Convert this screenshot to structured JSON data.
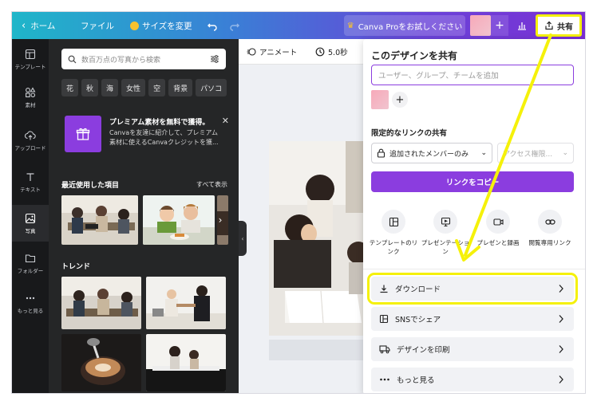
{
  "topbar": {
    "home": "ホーム",
    "file": "ファイル",
    "resize": "サイズを変更",
    "pro": "Canva Proをお試しください",
    "share": "共有"
  },
  "rail": [
    {
      "label": "テンプレート",
      "icon": "template-icon"
    },
    {
      "label": "素材",
      "icon": "elements-icon"
    },
    {
      "label": "アップロード",
      "icon": "upload-icon"
    },
    {
      "label": "テキスト",
      "icon": "text-icon"
    },
    {
      "label": "写真",
      "icon": "photo-icon"
    },
    {
      "label": "フォルダー",
      "icon": "folder-icon"
    },
    {
      "label": "もっと見る",
      "icon": "more-icon"
    }
  ],
  "panel": {
    "search_placeholder": "数百万点の写真から検索",
    "chips": [
      "花",
      "秋",
      "海",
      "女性",
      "空",
      "背景",
      "パソコ"
    ],
    "promo": {
      "title": "プレミアム素材を無料で獲得。",
      "body": "Canvaを友達に紹介して、プレミアム素材に使えるCanvaクレジットを獲..."
    },
    "recent_title": "最近使用した項目",
    "see_all": "すべて表示",
    "trend_title": "トレンド"
  },
  "editor": {
    "animate": "アニメート",
    "duration": "5.0秒"
  },
  "share_panel": {
    "title": "このデザインを共有",
    "input_placeholder": "ユーザー、グループ、チームを追加",
    "restricted_label": "限定的なリンクの共有",
    "access_selected": "追加されたメンバーのみ",
    "access_level": "アクセス権限...",
    "copy_link": "リンクをコピー",
    "options": [
      {
        "label": "テンプレートのリンク",
        "icon": "template-link-icon"
      },
      {
        "label": "プレゼンテーション",
        "icon": "present-icon"
      },
      {
        "label": "プレゼンと録画",
        "icon": "record-icon"
      },
      {
        "label": "閲覧専用リンク",
        "icon": "link-icon"
      }
    ],
    "rows": [
      {
        "label": "ダウンロード",
        "icon": "download-icon"
      },
      {
        "label": "SNSでシェア",
        "icon": "social-icon"
      },
      {
        "label": "デザインを印刷",
        "icon": "print-icon"
      },
      {
        "label": "もっと見る",
        "icon": "more-dots-icon"
      }
    ]
  },
  "colors": {
    "accent": "#8b3ddf",
    "highlight": "#f5f10a",
    "panel_dark": "#252627",
    "rail_dark": "#18191b"
  }
}
